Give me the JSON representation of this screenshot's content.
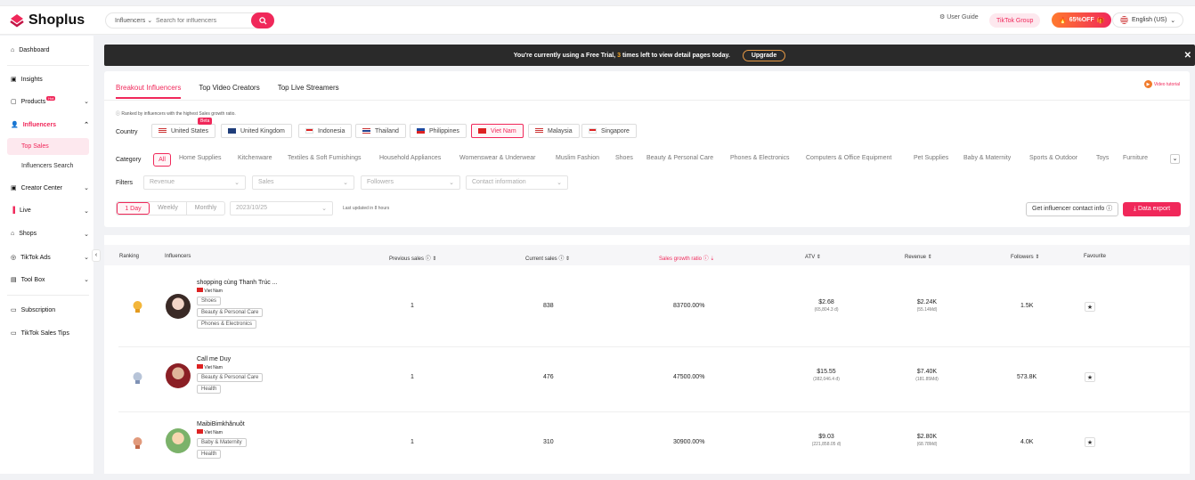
{
  "app": {
    "brand": "Shoplus"
  },
  "search": {
    "scope": "Influencers",
    "placeholder": "Search for influencers"
  },
  "topbar": {
    "user_guide": "User Guide",
    "tiktok_group": "TikTok Group",
    "promo": "65%OFF",
    "language": "English (US)"
  },
  "sidebar": {
    "items": [
      {
        "label": "Dashboard",
        "icon": "home-icon"
      },
      {
        "label": "Insights",
        "icon": "insights-icon"
      },
      {
        "label": "Products",
        "icon": "box-icon",
        "badge": "Hot"
      },
      {
        "label": "Influencers",
        "icon": "people-icon"
      },
      {
        "label": "Top Sales"
      },
      {
        "label": "Influencers Search"
      },
      {
        "label": "Creator Center",
        "icon": "creator-icon"
      },
      {
        "label": "Live",
        "icon": "bars-icon"
      },
      {
        "label": "Shops",
        "icon": "shop-icon"
      },
      {
        "label": "TikTok Ads",
        "icon": "ads-icon"
      },
      {
        "label": "Tool Box",
        "icon": "toolbox-icon"
      },
      {
        "label": "Subscription",
        "icon": "card-icon"
      },
      {
        "label": "TikTok Sales Tips",
        "icon": "chat-icon"
      }
    ]
  },
  "banner": {
    "text_before": "You're currently using a Free Trial,",
    "count": "3",
    "text_after": "times left to view detail pages today.",
    "upgrade": "Upgrade"
  },
  "panel": {
    "tabs": [
      "Breakout Influencers",
      "Top Video Creators",
      "Top Live Streamers"
    ],
    "video_tutorial": "Video tutorial",
    "note": "Ranked by influencers with the highest Sales growth ratio.",
    "country_label": "Country",
    "countries": [
      "United States",
      "United Kingdom",
      "Indonesia",
      "Thailand",
      "Philippines",
      "Viet Nam",
      "Malaysia",
      "Singapore"
    ],
    "selected_country": "Viet Nam",
    "beta_badge": "Beta",
    "category_label": "Category",
    "categories": [
      "All",
      "Home Supplies",
      "Kitchenware",
      "Textiles & Soft Furnishings",
      "Household Appliances",
      "Womenswear & Underwear",
      "Muslim Fashion",
      "Shoes",
      "Beauty & Personal Care",
      "Phones & Electronics",
      "Computers & Office Equipment",
      "Pet Supplies",
      "Baby & Maternity",
      "Sports & Outdoor",
      "Toys",
      "Furniture"
    ],
    "filters_label": "Filters",
    "filters": [
      "Revenue",
      "Sales",
      "Followers",
      "Contact information"
    ],
    "periods": [
      "1 Day",
      "Weekly",
      "Monthly"
    ],
    "date": "2023/10/25",
    "last_updated": "Last updated in 8 hours",
    "contact_btn": "Get influencer contact info",
    "export_btn": "Data export"
  },
  "table": {
    "headers": [
      "Ranking",
      "Influencers",
      "Previous sales",
      "Current sales",
      "Sales growth ratio",
      "ATV",
      "Revenue",
      "Followers",
      "Favourite"
    ],
    "rows": [
      {
        "name": "shopping cùng Thanh Trúc ...",
        "country": "Viet Nam",
        "tags": [
          "Shoes",
          "Beauty & Personal Care",
          "Phones & Electronics"
        ],
        "prev": "1",
        "cur": "838",
        "ratio": "83700.00%",
        "atv": "$2.68",
        "atv_local": "(65,804.3 đ)",
        "rev": "$2.24K",
        "rev_local": "(55.14Mđ)",
        "followers": "1.5K"
      },
      {
        "name": "Call me Duy",
        "country": "Viet Nam",
        "tags": [
          "Beauty & Personal Care",
          "Health"
        ],
        "prev": "1",
        "cur": "476",
        "ratio": "47500.00%",
        "atv": "$15.55",
        "atv_local": "(382,046.4 đ)",
        "rev": "$7.40K",
        "rev_local": "(181.85Mđ)",
        "followers": "573.8K"
      },
      {
        "name": "MaibiBimkhănuôt",
        "country": "Viet Nam",
        "tags": [
          "Baby & Maternity",
          "Health"
        ],
        "prev": "1",
        "cur": "310",
        "ratio": "30900.00%",
        "atv": "$9.03",
        "atv_local": "(221,858.05 đ)",
        "rev": "$2.80K",
        "rev_local": "(68.78Mđ)",
        "followers": "4.0K"
      }
    ]
  },
  "colors": {
    "accent": "#f0285a",
    "banner": "#2a2a2a"
  }
}
